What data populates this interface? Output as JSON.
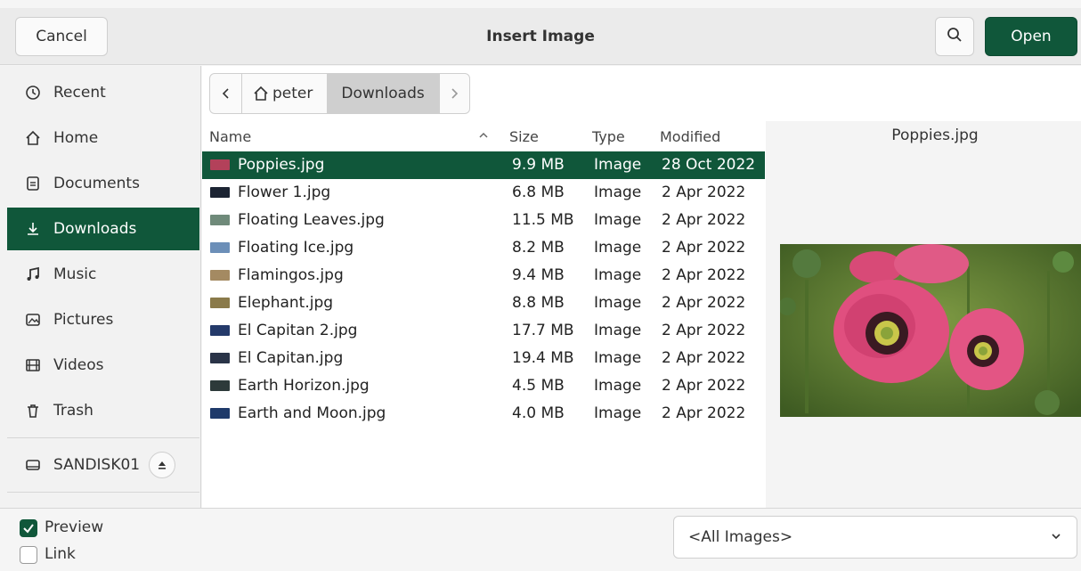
{
  "header": {
    "cancel_label": "Cancel",
    "title": "Insert Image",
    "open_label": "Open"
  },
  "sidebar": {
    "items": [
      {
        "label": "Recent",
        "icon": "clock-icon"
      },
      {
        "label": "Home",
        "icon": "home-icon"
      },
      {
        "label": "Documents",
        "icon": "document-icon"
      },
      {
        "label": "Downloads",
        "icon": "download-icon"
      },
      {
        "label": "Music",
        "icon": "music-icon"
      },
      {
        "label": "Pictures",
        "icon": "pictures-icon"
      },
      {
        "label": "Videos",
        "icon": "video-icon"
      },
      {
        "label": "Trash",
        "icon": "trash-icon"
      }
    ],
    "device": {
      "label": "SANDISK01",
      "icon": "drive-icon"
    }
  },
  "pathbar": {
    "home_label": "peter",
    "current_label": "Downloads"
  },
  "columns": {
    "name": "Name",
    "size": "Size",
    "type": "Type",
    "modified": "Modified"
  },
  "files": [
    {
      "name": "Poppies.jpg",
      "size": "9.9 MB",
      "type": "Image",
      "modified": "28 Oct 2022",
      "color": "#b3415a"
    },
    {
      "name": "Flower 1.jpg",
      "size": "6.8 MB",
      "type": "Image",
      "modified": "2 Apr 2022",
      "color": "#1c2433"
    },
    {
      "name": "Floating Leaves.jpg",
      "size": "11.5 MB",
      "type": "Image",
      "modified": "2 Apr 2022",
      "color": "#6f8a7a"
    },
    {
      "name": "Floating Ice.jpg",
      "size": "8.2 MB",
      "type": "Image",
      "modified": "2 Apr 2022",
      "color": "#6c8fb8"
    },
    {
      "name": "Flamingos.jpg",
      "size": "9.4 MB",
      "type": "Image",
      "modified": "2 Apr 2022",
      "color": "#a48a62"
    },
    {
      "name": "Elephant.jpg",
      "size": "8.8 MB",
      "type": "Image",
      "modified": "2 Apr 2022",
      "color": "#8a7a4a"
    },
    {
      "name": "El Capitan 2.jpg",
      "size": "17.7 MB",
      "type": "Image",
      "modified": "2 Apr 2022",
      "color": "#243a6a"
    },
    {
      "name": "El Capitan.jpg",
      "size": "19.4 MB",
      "type": "Image",
      "modified": "2 Apr 2022",
      "color": "#2a3448"
    },
    {
      "name": "Earth Horizon.jpg",
      "size": "4.5 MB",
      "type": "Image",
      "modified": "2 Apr 2022",
      "color": "#2d3a3a"
    },
    {
      "name": "Earth and Moon.jpg",
      "size": "4.0 MB",
      "type": "Image",
      "modified": "2 Apr 2022",
      "color": "#1e3a6a"
    }
  ],
  "preview": {
    "filename": "Poppies.jpg"
  },
  "footer": {
    "preview_label": "Preview",
    "preview_checked": true,
    "link_label": "Link",
    "link_checked": false,
    "filter_value": "<All Images>"
  },
  "colors": {
    "accent": "#10573a"
  }
}
